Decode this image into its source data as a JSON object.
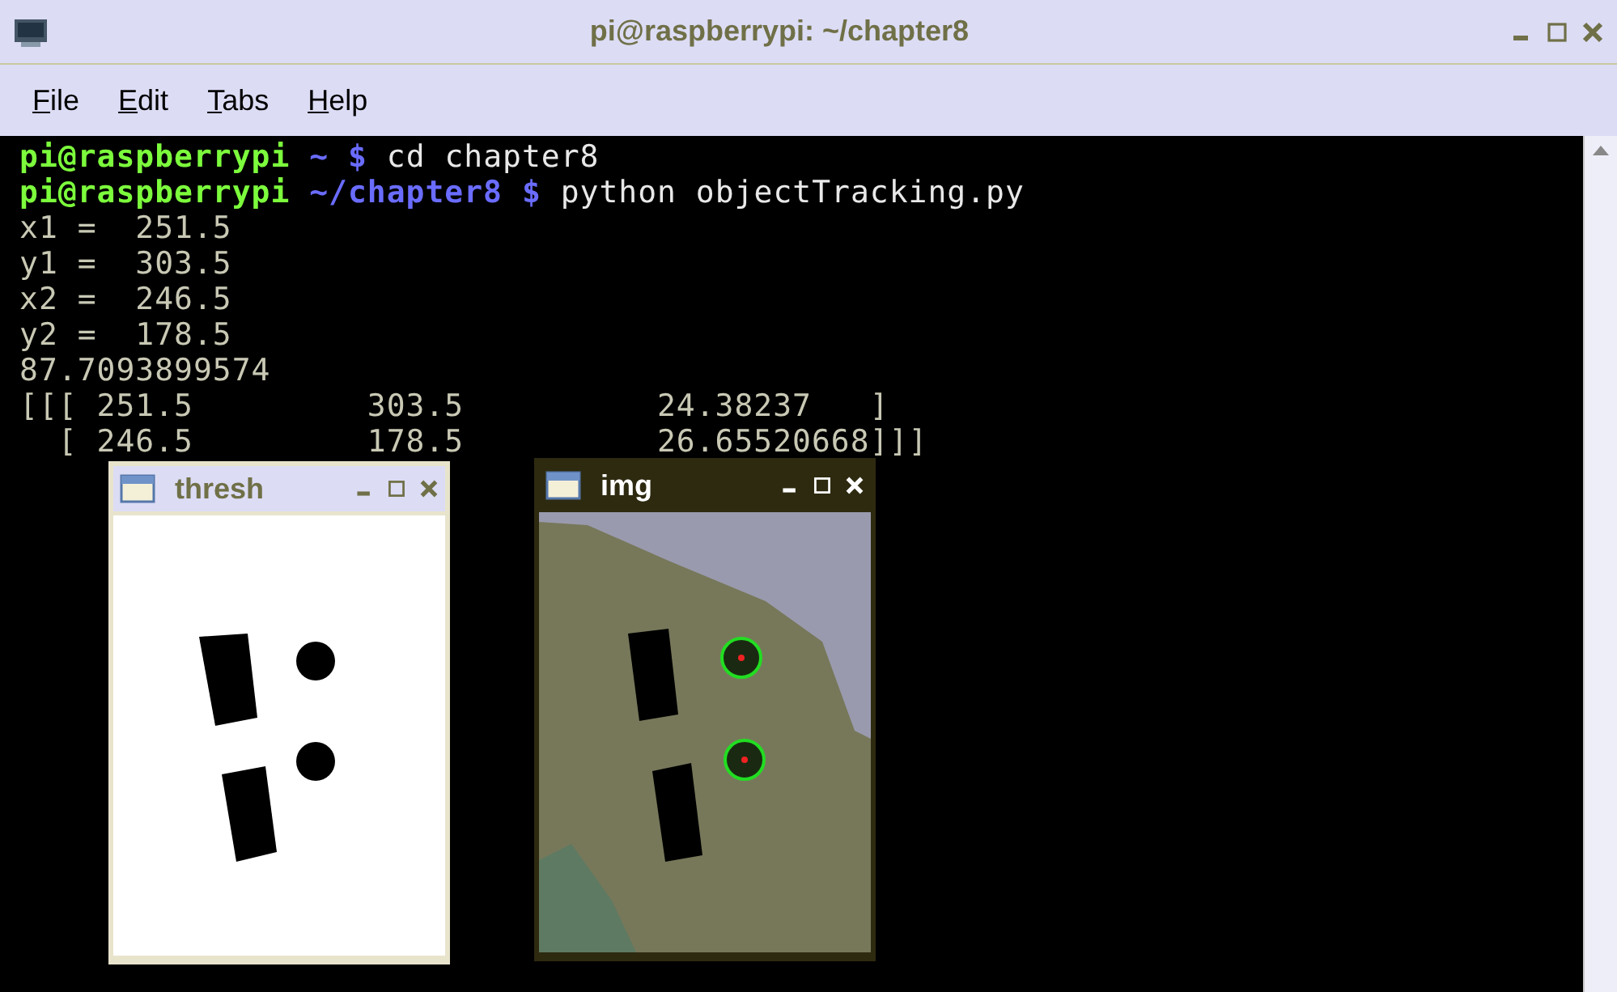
{
  "window": {
    "title": "pi@raspberrypi: ~/chapter8"
  },
  "menu": [
    {
      "label": "File",
      "mnemonic_underlined": true
    },
    {
      "label": "Edit",
      "mnemonic_underlined": true
    },
    {
      "label": "Tabs",
      "mnemonic_underlined": true
    },
    {
      "label": "Help",
      "mnemonic_underlined": true
    }
  ],
  "terminal_lines": [
    {
      "kind": "prompt",
      "user": "pi@raspberrypi",
      "path": "~",
      "symbol": "$",
      "command": "cd chapter8"
    },
    {
      "kind": "prompt",
      "user": "pi@raspberrypi",
      "path": "~/chapter8",
      "symbol": "$",
      "command": "python objectTracking.py"
    },
    {
      "kind": "output",
      "text": "x1 =  251.5"
    },
    {
      "kind": "output",
      "text": "y1 =  303.5"
    },
    {
      "kind": "output",
      "text": "x2 =  246.5"
    },
    {
      "kind": "output",
      "text": "y2 =  178.5"
    },
    {
      "kind": "output",
      "text": "87.7093899574"
    },
    {
      "kind": "output",
      "text": "[[[ 251.5         303.5          24.38237   ]"
    },
    {
      "kind": "output",
      "text": "  [ 246.5         178.5          26.65520668]]]"
    }
  ],
  "image_windows": [
    {
      "title": "thresh",
      "kind": "threshold",
      "active": false
    },
    {
      "title": "img",
      "kind": "camera",
      "active": true
    }
  ]
}
